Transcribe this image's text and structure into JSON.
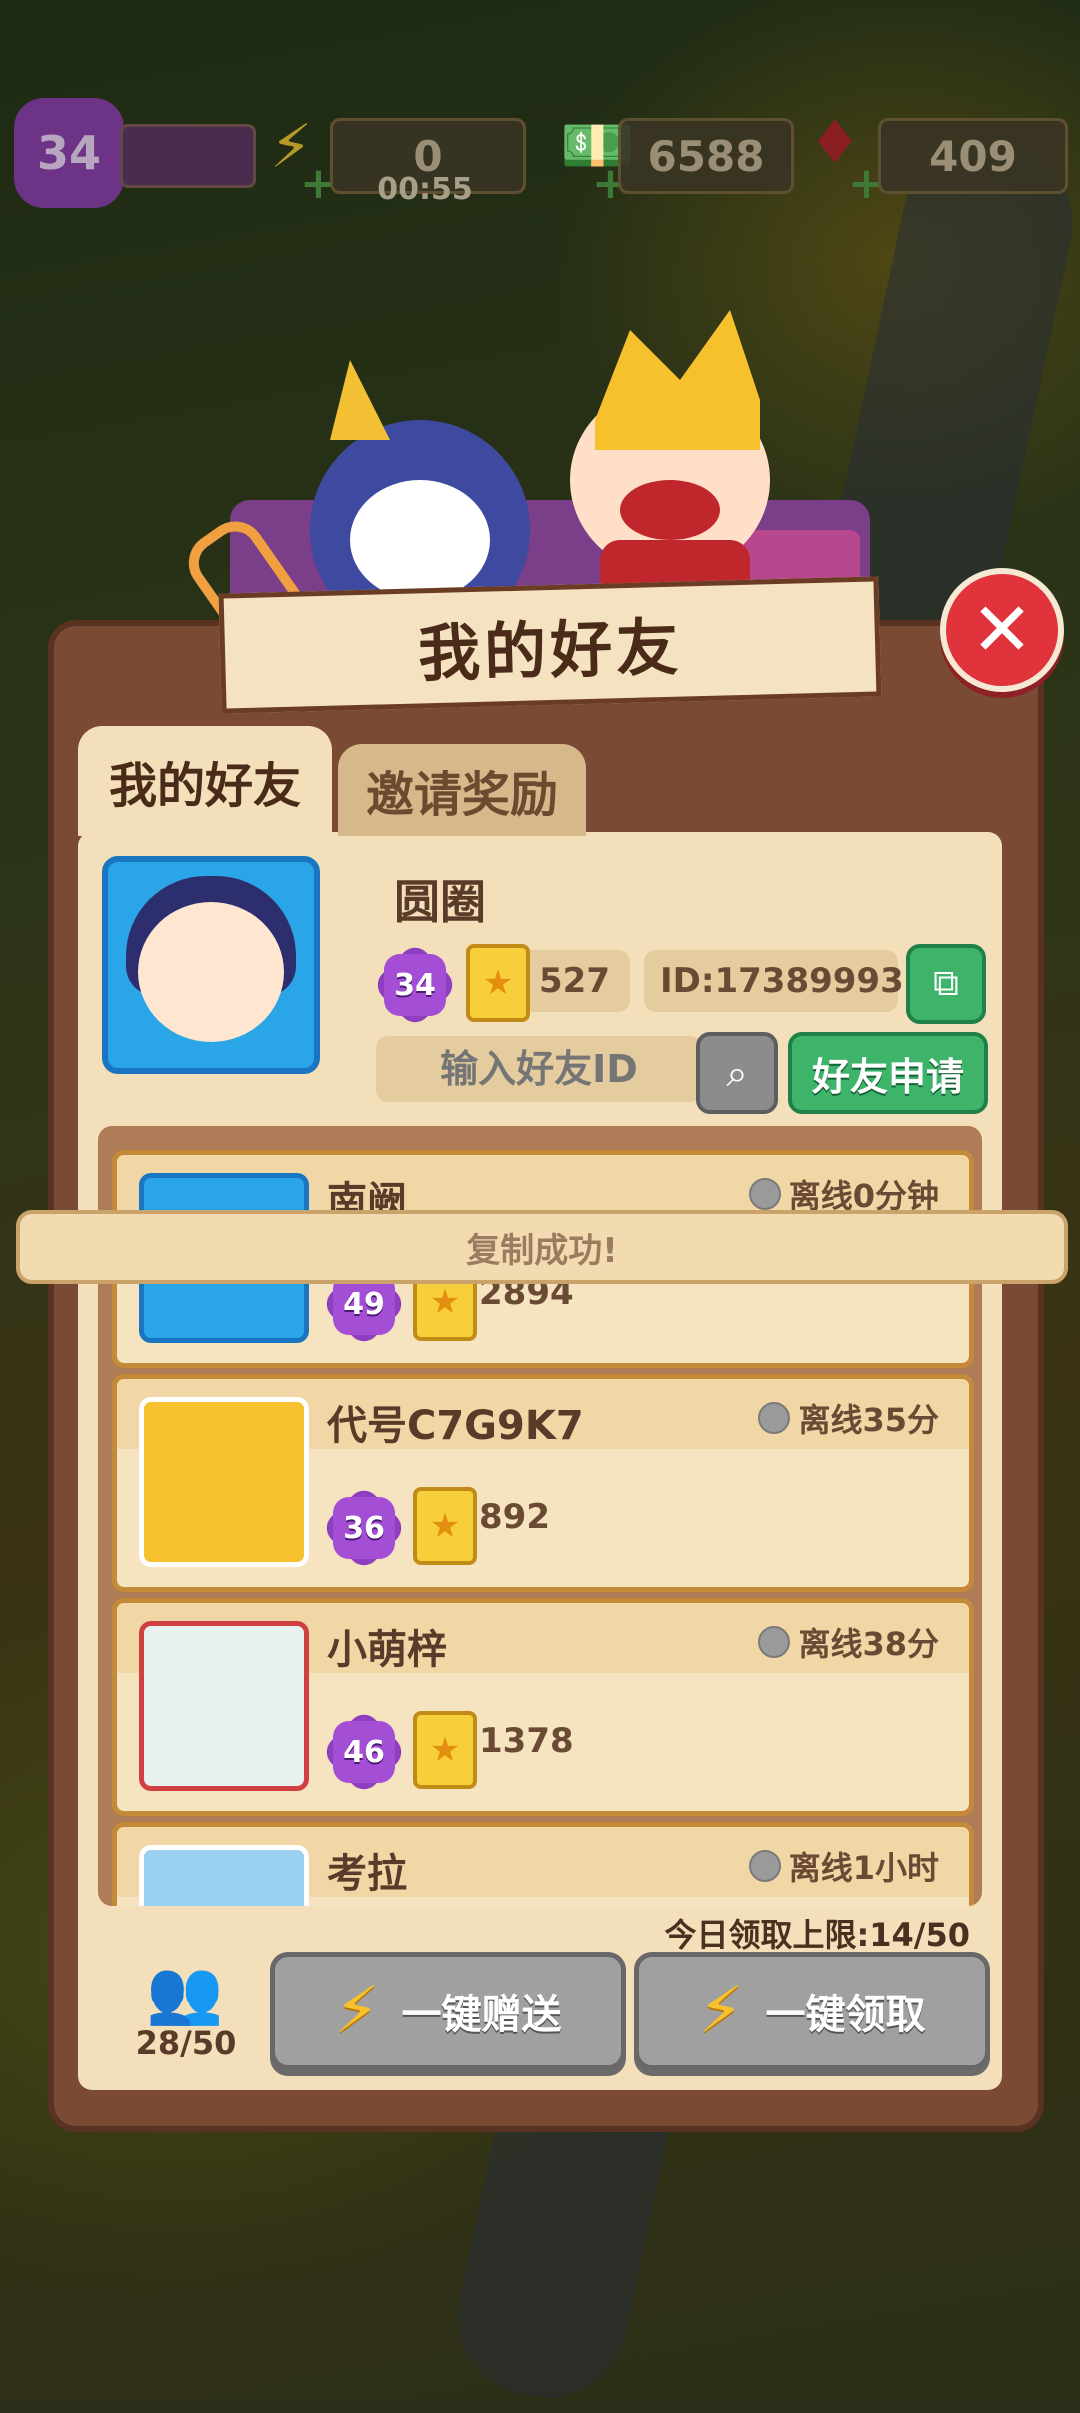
{
  "hud": {
    "level": "34",
    "energy": "0",
    "energy_timer": "00:55",
    "cash": "6588",
    "gems": "409"
  },
  "dialog": {
    "title": "我的好友",
    "tabs": [
      {
        "label": "我的好友",
        "active": true
      },
      {
        "label": "邀请奖励",
        "active": false
      }
    ]
  },
  "me": {
    "name": "圆圈",
    "level": "34",
    "cards": "527",
    "id_text": "ID:17389993",
    "search_placeholder": "输入好友ID",
    "apply_label": "好友申请"
  },
  "friends": [
    {
      "name": "南阙",
      "level": "49",
      "cards": "2894",
      "status": "离线0分钟"
    },
    {
      "name": "代号C7G9K7",
      "level": "36",
      "cards": "892",
      "status": "离线35分"
    },
    {
      "name": "小萌梓",
      "level": "46",
      "cards": "1378",
      "status": "离线38分"
    },
    {
      "name": "考拉",
      "level": "",
      "cards": "",
      "status": "离线1小时"
    }
  ],
  "toast": "复制成功!",
  "footer": {
    "daily_limit": "今日领取上限:14/50",
    "friend_count": "28/50",
    "send_all": "一键赠送",
    "claim_all": "一键领取"
  },
  "colors": {
    "panel": "#7a4a34",
    "inner": "#f3dfb9",
    "green_button": "#3db46a",
    "close_red": "#e0333b",
    "level_purple": "#a44ed6"
  }
}
